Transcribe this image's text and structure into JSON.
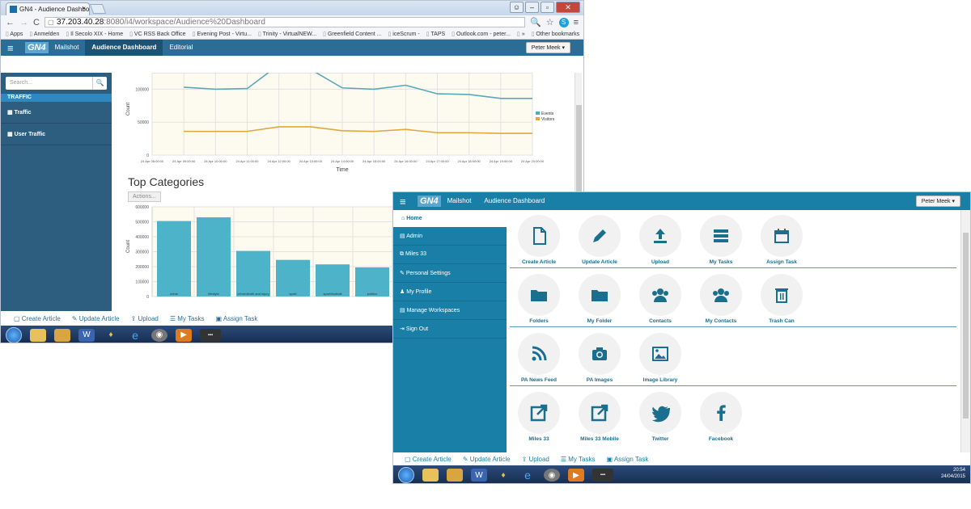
{
  "browser": {
    "tab_title": "GN4 - Audience Dashboa",
    "tab_close": "×",
    "url_host": "37.203.40.28",
    "url_path": ":8080/i4/workspace/Audience%20Dashboard",
    "bookmarks": [
      "Apps",
      "Anmelden",
      "Il Secolo XIX - Home",
      "VC RSS Back Office",
      "Evening Post - Virtu...",
      "Trinity - VirtualNEW...",
      "Greenfield Content ...",
      "iceScrum -",
      "TAPS",
      "Outlook.com - peter...",
      "»",
      "Other bookmarks"
    ]
  },
  "appA": {
    "logo": "GN4",
    "nav": [
      "Mailshot",
      "Audience Dashboard",
      "Editorial"
    ],
    "user": "Peter Meek ▾",
    "search_placeholder": "Search...",
    "section": "TRAFFIC",
    "side_items": [
      "Traffic",
      "User Traffic"
    ],
    "categories_title": "Top Categories",
    "actions_label": "Actions...",
    "toolbar": [
      "Create Article",
      "Update Article",
      "Upload",
      "My Tasks",
      "Assign Task"
    ]
  },
  "appB": {
    "logo": "GN4",
    "nav": [
      "Mailshot",
      "Audience Dashboard"
    ],
    "user": "Peter Meek ▾",
    "home": "Home",
    "side_items": [
      "Admin",
      "Miles 33",
      "Personal Settings",
      "My Profile",
      "Manage Workspaces",
      "Sign Out"
    ],
    "tiles": [
      [
        "Create Article",
        "Update Article",
        "Upload",
        "My Tasks",
        "Assign Task"
      ],
      [
        "Folders",
        "My Folder",
        "Contacts",
        "My Contacts",
        "Trash Can"
      ],
      [
        "PA News Feed",
        "PA Images",
        "Image Library"
      ],
      [
        "Miles 33",
        "Miles 33 Mobile",
        "Twitter",
        "Facebook"
      ]
    ],
    "toolbar": [
      "Create Article",
      "Update Article",
      "Upload",
      "My Tasks",
      "Assign Task"
    ],
    "clock_time": "20:54",
    "clock_date": "24/04/2015"
  },
  "chart_data": [
    {
      "type": "line",
      "x": [
        "24 Apr 08:00:00",
        "24 Apr 09:00:00",
        "24 Apr 10:00:00",
        "24 Apr 11:00:00",
        "24 Apr 12:00:00",
        "24 Apr 13:00:00",
        "24 Apr 14:00:00",
        "24 Apr 15:00:00",
        "24 Apr 16:00:00",
        "24 Apr 17:00:00",
        "24 Apr 18:00:00",
        "24 Apr 19:00:00",
        "24 Apr 20:00:00"
      ],
      "series": [
        {
          "name": "Events",
          "values": [
            null,
            103000,
            100000,
            101000,
            137000,
            130000,
            102000,
            100000,
            106000,
            93000,
            92000,
            86000,
            86000
          ]
        },
        {
          "name": "Visitors",
          "values": [
            null,
            36000,
            36000,
            36000,
            43000,
            43000,
            37000,
            36000,
            39000,
            34000,
            34000,
            33000,
            33000
          ]
        }
      ],
      "yticks": [
        "0",
        "50000",
        "100000"
      ],
      "ylim": [
        0,
        125000
      ],
      "xlabel": "Time",
      "ylabel": "Count",
      "colors": [
        "#5aa7bb",
        "#e0a83a"
      ],
      "legend": "right"
    },
    {
      "type": "bar",
      "categories": [
        "crime",
        "lifestyle",
        "crime/death and injury",
        "sport",
        "sport/football",
        "politics"
      ],
      "values": [
        505000,
        530000,
        305000,
        245000,
        215000,
        195000
      ],
      "yticks": [
        "0",
        "100000",
        "200000",
        "300000",
        "400000",
        "500000",
        "600000"
      ],
      "ylim": [
        0,
        600000
      ],
      "ylabel": "Count",
      "color": "#4db3c9"
    }
  ]
}
